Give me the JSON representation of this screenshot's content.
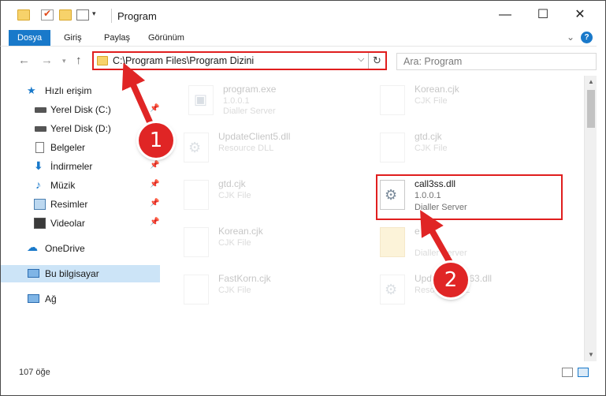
{
  "window": {
    "title": "Program",
    "controls": [
      "—",
      "☐",
      "✕"
    ]
  },
  "ribbon": {
    "tabs": [
      "Dosya",
      "Giriş",
      "Paylaş",
      "Görünüm"
    ],
    "expand_icon": "chevron-down-icon",
    "help_label": "?"
  },
  "address": {
    "path": "C:\\Program Files\\Program Dizini",
    "dropdown": "⌵",
    "refresh": "↻"
  },
  "search": {
    "placeholder": "Ara: Program"
  },
  "sidebar": {
    "items": [
      {
        "label": "Hızlı erişim",
        "icon": "star-icon",
        "pinned": false
      },
      {
        "label": "Yerel Disk (C:)",
        "icon": "drive-icon",
        "pinned": true
      },
      {
        "label": "Yerel Disk (D:)",
        "icon": "drive-icon",
        "pinned": true
      },
      {
        "label": "Belgeler",
        "icon": "document-icon",
        "pinned": true
      },
      {
        "label": "İndirmeler",
        "icon": "download-icon",
        "pinned": true
      },
      {
        "label": "Müzik",
        "icon": "music-icon",
        "pinned": true
      },
      {
        "label": "Resimler",
        "icon": "picture-icon",
        "pinned": true
      },
      {
        "label": "Videolar",
        "icon": "video-icon",
        "pinned": true
      },
      {
        "label": "OneDrive",
        "icon": "cloud-icon",
        "pinned": false
      },
      {
        "label": "Bu bilgisayar",
        "icon": "computer-icon",
        "pinned": false,
        "selected": true
      },
      {
        "label": "Ağ",
        "icon": "network-icon",
        "pinned": false
      }
    ]
  },
  "files": [
    {
      "name": "program.exe",
      "line1": "1.0.0.1",
      "line2": "Dialler Server",
      "kind": "exe",
      "faded": true
    },
    {
      "name": "Korean.cjk",
      "line1": "CJK File",
      "line2": "",
      "kind": "blank",
      "faded": true
    },
    {
      "name": "UpdateClient5.dll",
      "line1": "Resource DLL",
      "line2": "",
      "kind": "dll",
      "faded": true
    },
    {
      "name": "gtd.cjk",
      "line1": "CJK File",
      "line2": "",
      "kind": "blank",
      "faded": true
    },
    {
      "name": "gtd.cjk",
      "line1": "CJK File",
      "line2": "",
      "kind": "blank",
      "faded": true
    },
    {
      "name": "call3ss.dll",
      "line1": "1.0.0.1",
      "line2": "Dialler Server",
      "kind": "dll",
      "faded": false
    },
    {
      "name": "Korean.cjk",
      "line1": "CJK File",
      "line2": "",
      "kind": "blank",
      "faded": true
    },
    {
      "name": "e",
      "line1": "",
      "line2": "Dialler Server",
      "kind": "yfold",
      "faded": true
    },
    {
      "name": "FastKorn.cjk",
      "line1": "CJK File",
      "line2": "",
      "kind": "blank",
      "faded": true
    },
    {
      "name": "UpdateClient63.dll",
      "line1": "Resource DLL",
      "line2": "",
      "kind": "dll",
      "faded": true
    }
  ],
  "status": {
    "count": "107 öğe"
  },
  "annotations": {
    "badge1": "1",
    "badge2": "2",
    "color": "#e02525"
  }
}
